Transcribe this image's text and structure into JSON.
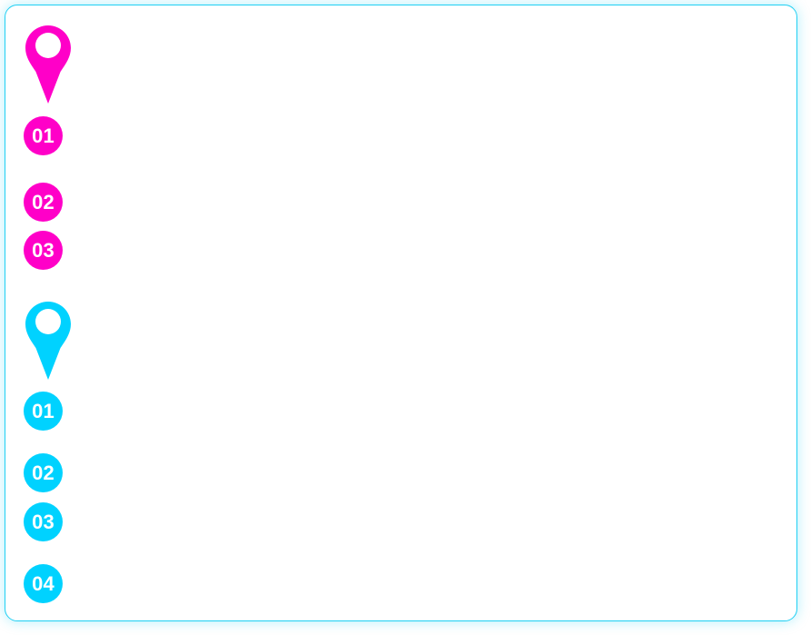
{
  "colors": {
    "frame_border": "#21d0f3",
    "magenta": "#ff00c8",
    "cyan": "#00d2ff",
    "badge_text": "#ffffff"
  },
  "groups": [
    {
      "color": "magenta",
      "icon": "location-pin-icon",
      "items": [
        "01",
        "02",
        "03"
      ]
    },
    {
      "color": "cyan",
      "icon": "location-pin-icon",
      "items": [
        "01",
        "02",
        "03",
        "04"
      ]
    }
  ]
}
